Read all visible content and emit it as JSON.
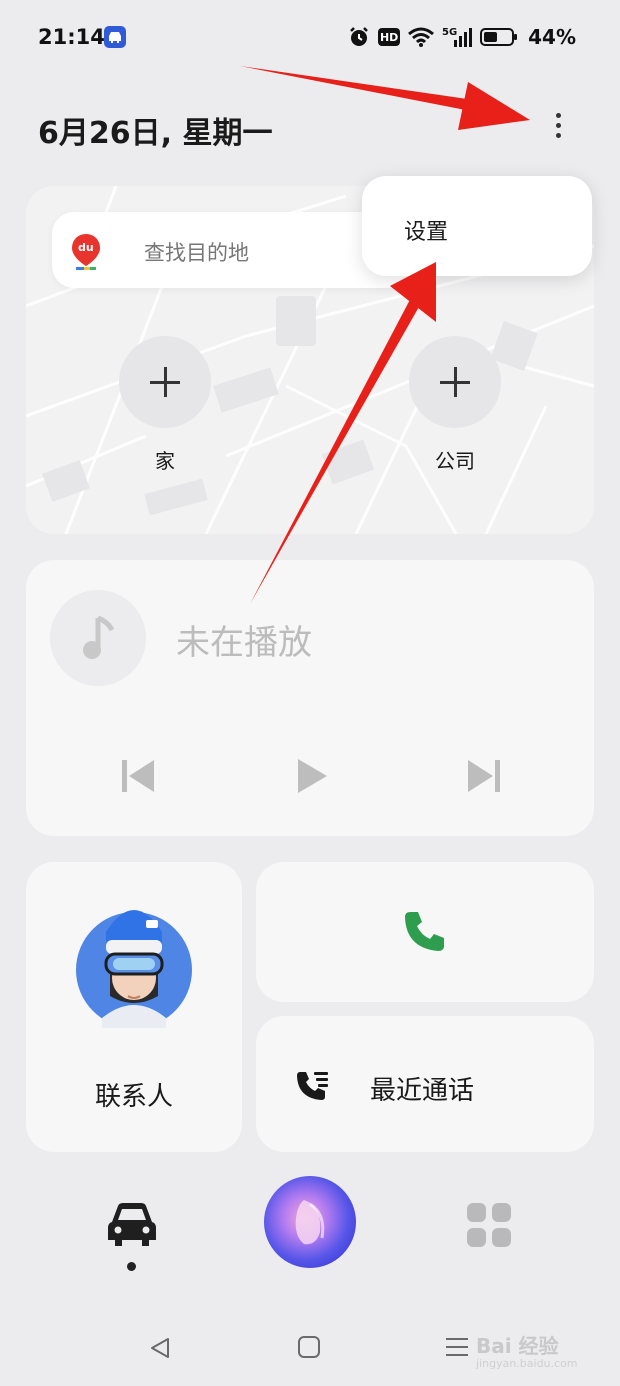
{
  "status_bar": {
    "time": "21:14",
    "battery": "44%",
    "hd_badge": "HD",
    "network": "5G"
  },
  "header": {
    "date": "6月26日, 星期一"
  },
  "navigation_card": {
    "search_placeholder": "查找目的地",
    "home_label": "家",
    "work_label": "公司",
    "map_logo_text": "du"
  },
  "popup_menu": {
    "items": [
      {
        "label": "设置"
      }
    ]
  },
  "music": {
    "status": "未在播放"
  },
  "contacts": {
    "label": "联系人"
  },
  "recent_calls": {
    "label": "最近通话"
  },
  "bottom_nav": {
    "active": "car",
    "colors": {
      "assistant_start": "#f4a9d9",
      "assistant_end": "#2a2ad0"
    }
  },
  "watermark": {
    "brand": "Bai 经验",
    "url": "jingyan.baidu.com"
  },
  "accent_colors": {
    "phone_green": "#2e9e4e",
    "annotation_arrow": "#e8201a"
  }
}
